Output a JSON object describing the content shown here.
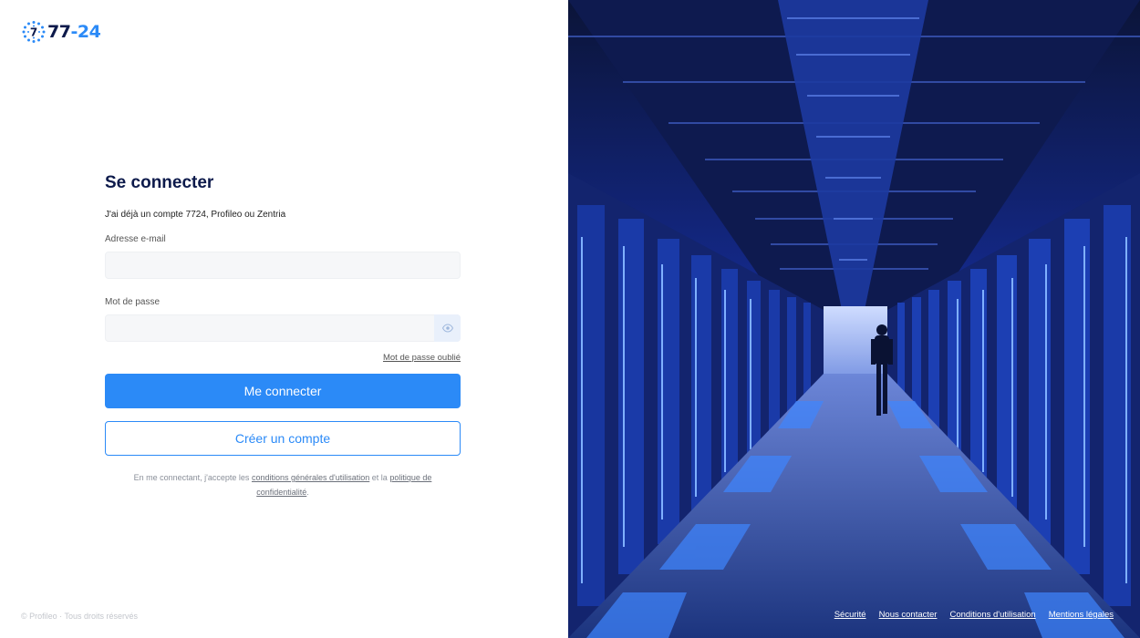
{
  "brand": {
    "logo_mark_digit": "7",
    "logo_part1": "77",
    "logo_dash": "-",
    "logo_part2": "24",
    "colors": {
      "navy": "#0d1a4b",
      "accent": "#2b8af7"
    }
  },
  "login": {
    "title": "Se connecter",
    "subtitle": "J'ai déjà un compte 7724, Profileo ou Zentria",
    "email_label": "Adresse e-mail",
    "email_value": "",
    "email_placeholder": "",
    "password_label": "Mot de passe",
    "password_value": "",
    "password_placeholder": "",
    "toggle_password_icon": "eye-icon",
    "forgot_password": "Mot de passe oublié",
    "submit_label": "Me connecter",
    "create_account_label": "Créer un compte",
    "legal_prefix": "En me connectant, j'accepte les",
    "legal_terms_link": "conditions générales d'utilisation",
    "legal_middle": "et la",
    "legal_privacy_link": "politique de confidentialité",
    "legal_suffix": "."
  },
  "footer": {
    "copyright": "© Profileo · Tous droits réservés",
    "links": [
      "Sécurité",
      "Nous contacter",
      "Conditions d'utilisation",
      "Mentions légales"
    ]
  },
  "hero": {
    "image_subject": "data-center-corridor"
  }
}
